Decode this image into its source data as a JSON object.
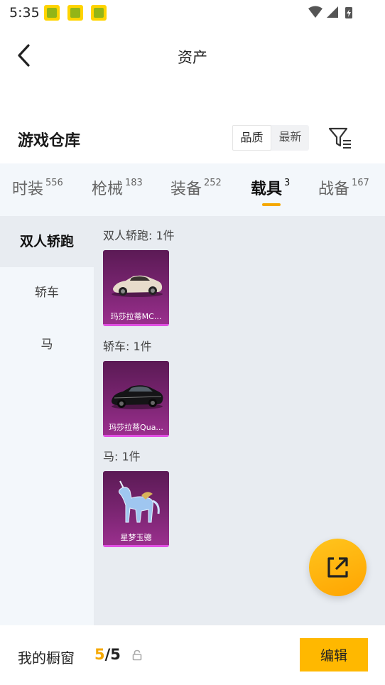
{
  "status_bar": {
    "time": "5:35"
  },
  "header": {
    "title": "资产"
  },
  "section": {
    "title": "游戏仓库",
    "sort_options": [
      "品质",
      "最新"
    ],
    "sort_selected": "品质"
  },
  "tabs": [
    {
      "label": "时装",
      "count": "556"
    },
    {
      "label": "枪械",
      "count": "183"
    },
    {
      "label": "装备",
      "count": "252"
    },
    {
      "label": "载具",
      "count": "3",
      "active": true
    },
    {
      "label": "战备",
      "count": "167"
    }
  ],
  "sidebar": {
    "items": [
      {
        "label": "双人轿跑",
        "active": true
      },
      {
        "label": "轿车"
      },
      {
        "label": "马"
      }
    ]
  },
  "groups": [
    {
      "label": "双人轿跑: 1件",
      "items": [
        {
          "name": "玛莎拉蒂MC...",
          "icon": "white-sports-car-icon"
        }
      ]
    },
    {
      "label": "轿车: 1件",
      "items": [
        {
          "name": "玛莎拉蒂Qua...",
          "icon": "black-sedan-icon"
        }
      ]
    },
    {
      "label": "马: 1件",
      "items": [
        {
          "name": "星梦玉骢",
          "icon": "crystal-unicorn-horse-icon"
        }
      ]
    }
  ],
  "bottom_bar": {
    "label": "我的橱窗",
    "current": "5",
    "separator": "/",
    "total": "5",
    "edit_label": "编辑"
  },
  "colors": {
    "accent": "#f5a800",
    "card_bg": "#7b2572",
    "card_border": "#e04fe2",
    "tabs_bg": "#f3f7fb",
    "content_bg": "#e8ecf1"
  }
}
